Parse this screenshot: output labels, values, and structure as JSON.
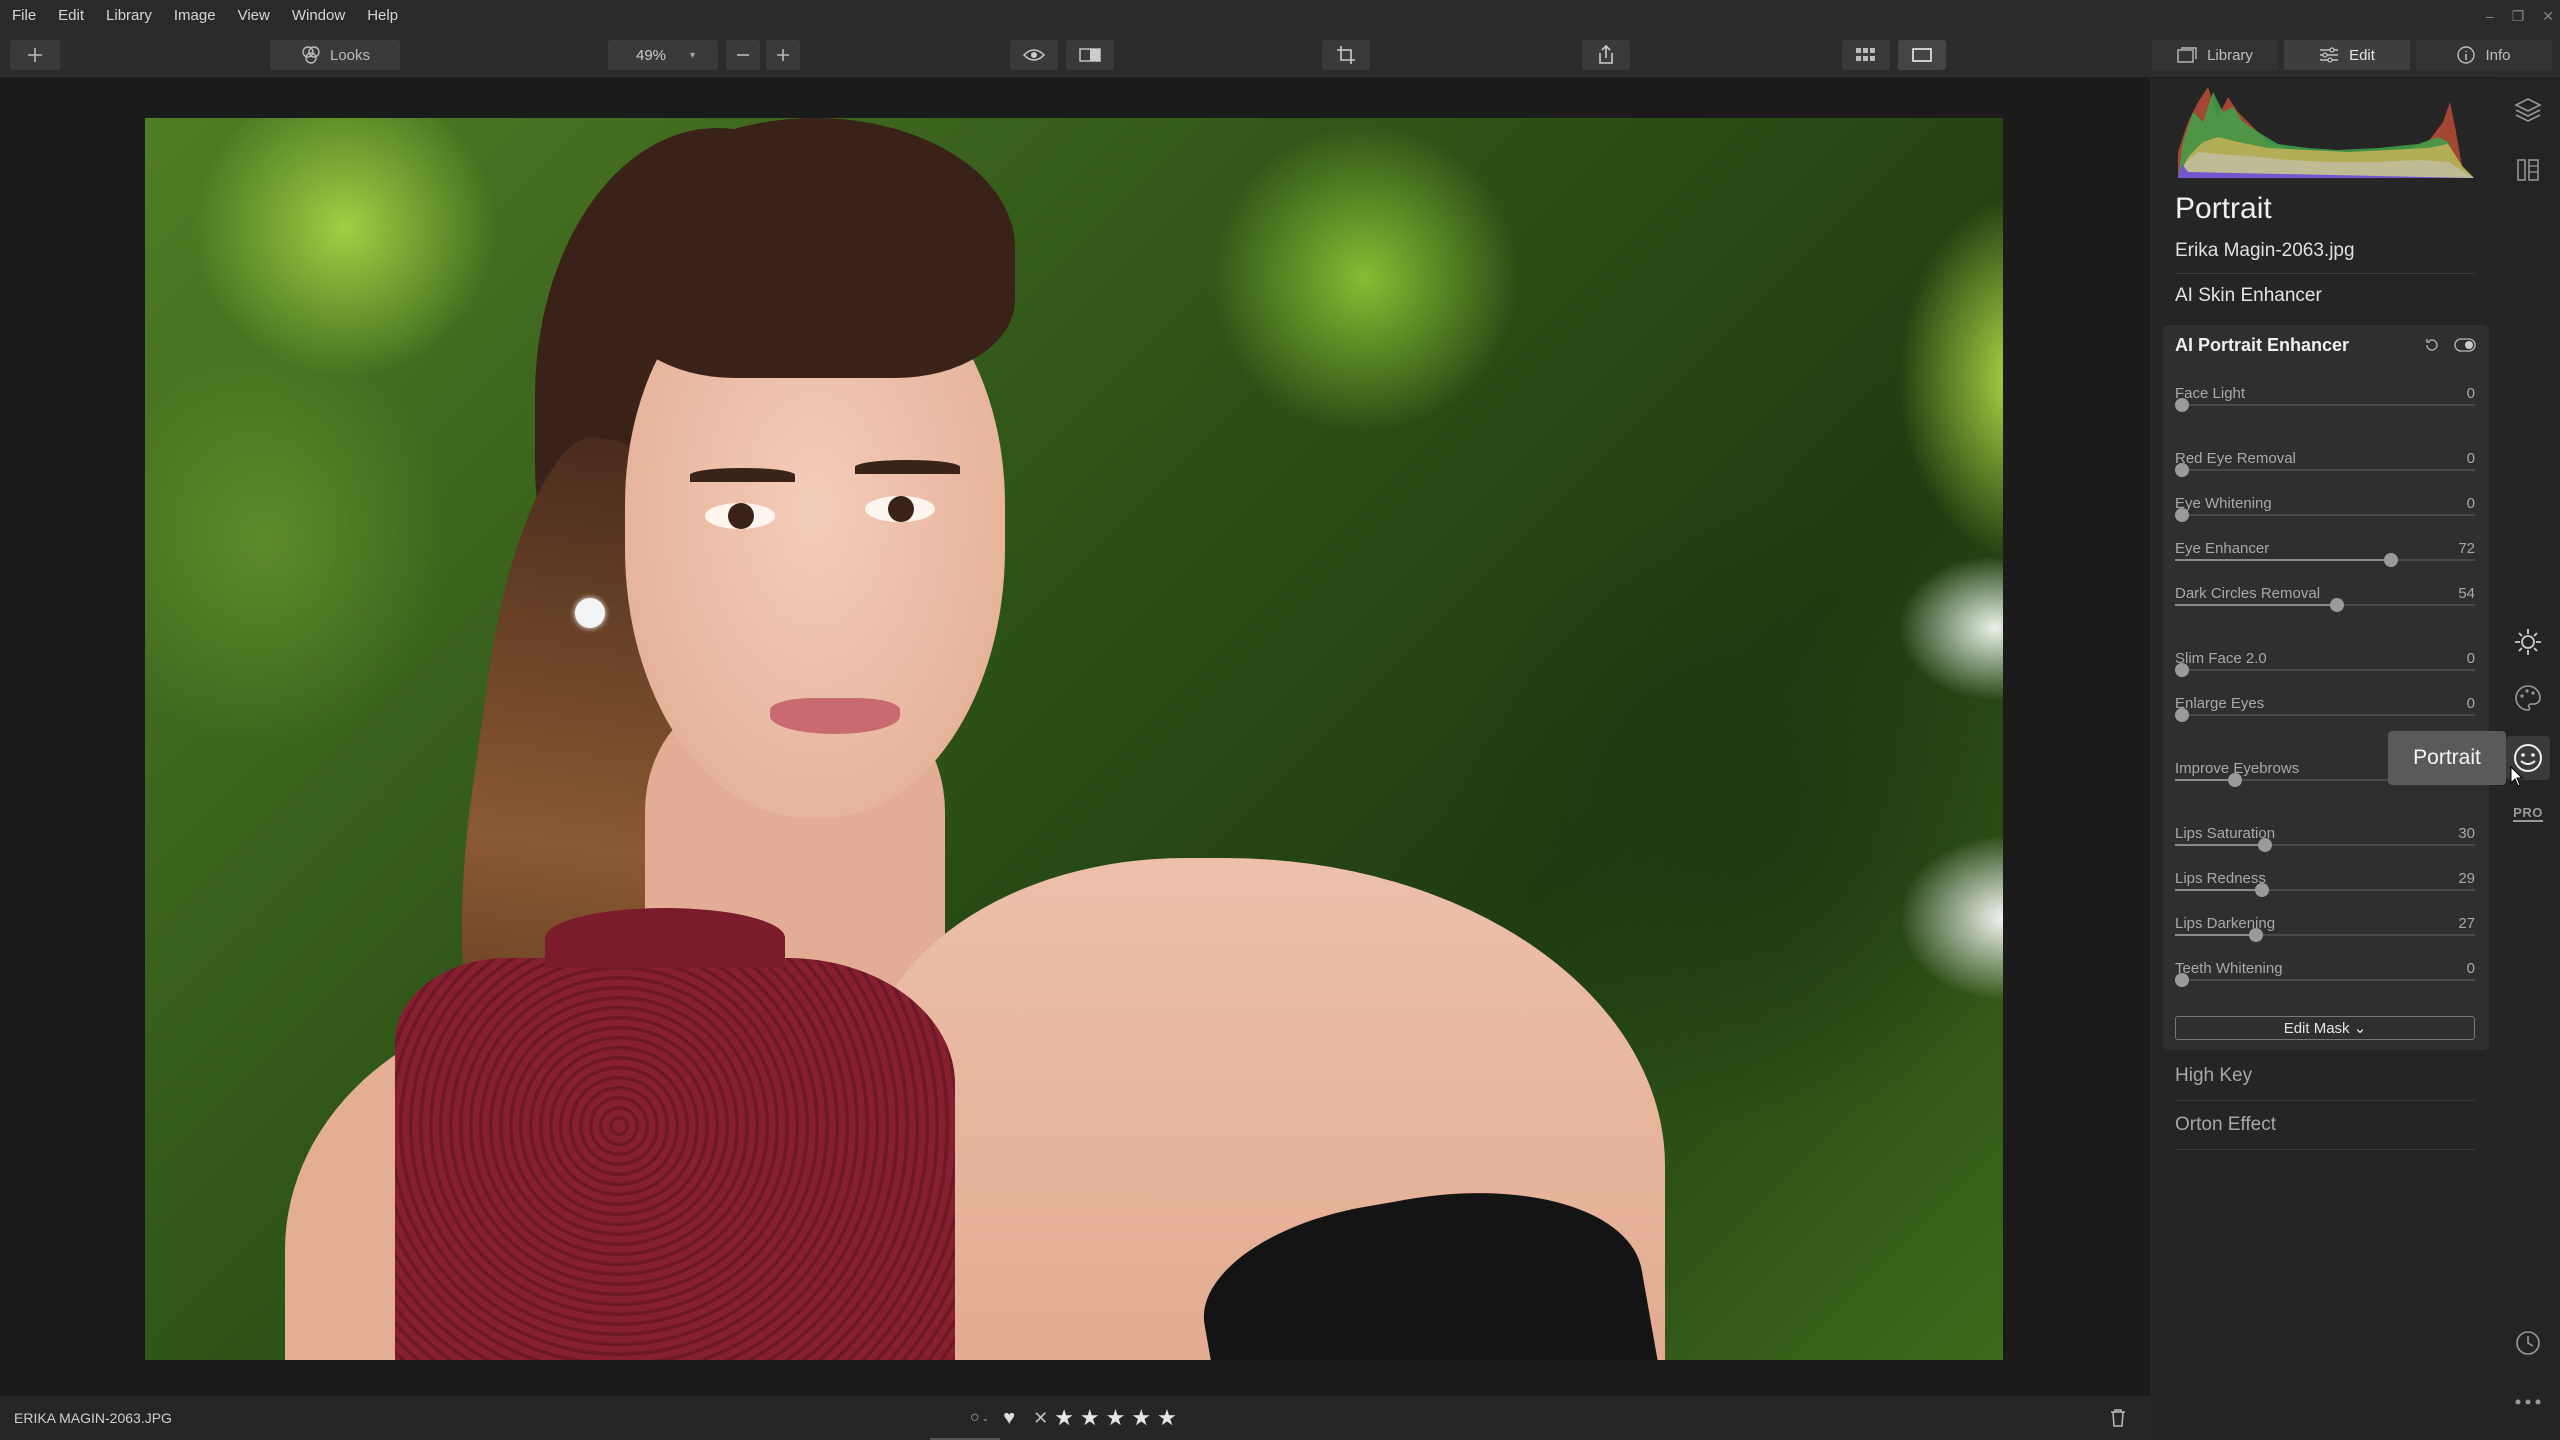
{
  "menu": [
    "File",
    "Edit",
    "Library",
    "Image",
    "View",
    "Window",
    "Help"
  ],
  "toolbar": {
    "looks_label": "Looks",
    "zoom_value": "49%"
  },
  "tabs": [
    {
      "label": "Library",
      "icon": "library-icon"
    },
    {
      "label": "Edit",
      "icon": "sliders-icon",
      "active": true
    },
    {
      "label": "Info",
      "icon": "info-icon"
    }
  ],
  "panel": {
    "title": "Portrait",
    "filename": "Erika Magin-2063.jpg",
    "collapsed_sections_top": [
      "AI Skin Enhancer"
    ],
    "enhancer": {
      "title": "AI Portrait Enhancer",
      "sliders": [
        {
          "label": "Face Light",
          "value": "0",
          "percent": 0
        },
        {
          "label": "Red Eye Removal",
          "value": "0",
          "percent": 0
        },
        {
          "label": "Eye Whitening",
          "value": "0",
          "percent": 0
        },
        {
          "label": "Eye Enhancer",
          "value": "72",
          "percent": 72
        },
        {
          "label": "Dark Circles Removal",
          "value": "54",
          "percent": 54
        },
        {
          "label": "Slim Face 2.0",
          "value": "0",
          "percent": 0
        },
        {
          "label": "Enlarge Eyes",
          "value": "0",
          "percent": 0
        },
        {
          "label": "Improve Eyebrows",
          "value": "",
          "percent": 20
        },
        {
          "label": "Lips Saturation",
          "value": "30",
          "percent": 30
        },
        {
          "label": "Lips Redness",
          "value": "29",
          "percent": 29
        },
        {
          "label": "Lips Darkening",
          "value": "27",
          "percent": 27
        },
        {
          "label": "Teeth Whitening",
          "value": "0",
          "percent": 0
        }
      ],
      "edit_mask_label": "Edit Mask ⌄"
    },
    "collapsed_sections_bottom": [
      "High Key",
      "Orton Effect"
    ]
  },
  "tooltip": "Portrait",
  "rail_icons": [
    "layers-icon",
    "presets-icon",
    "sun-icon",
    "palette-icon",
    "portrait-face-icon",
    "pro-icon",
    "history-icon",
    "more-icon"
  ],
  "rail_pro_label": "PRO",
  "bottom": {
    "filename": "ERIKA MAGIN-2063.JPG",
    "rating_stars": 5
  }
}
